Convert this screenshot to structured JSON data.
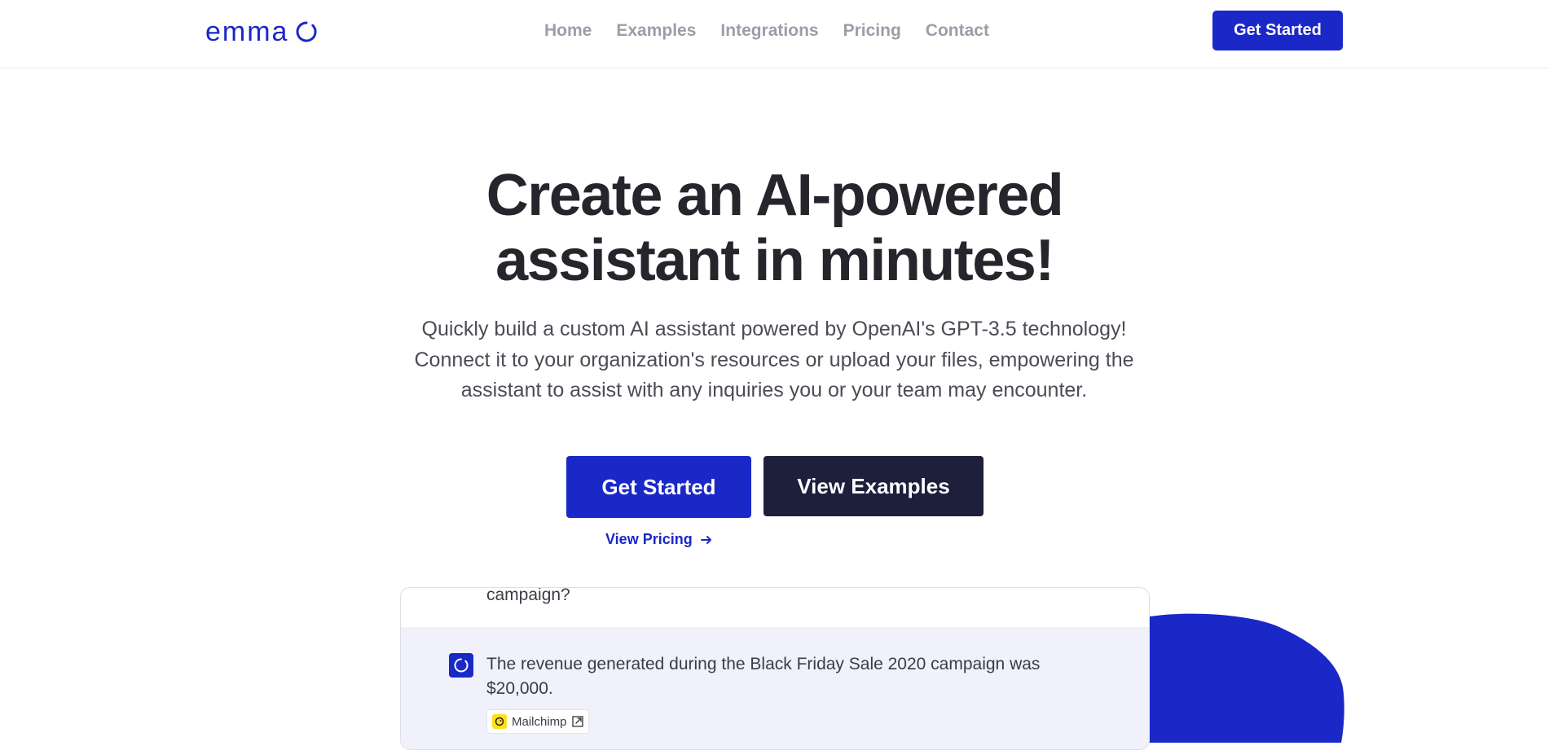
{
  "brand": {
    "name": "emma",
    "primary_color": "#1a28c8",
    "dark_color": "#1d1f3b"
  },
  "nav": {
    "items": [
      "Home",
      "Examples",
      "Integrations",
      "Pricing",
      "Contact"
    ]
  },
  "header": {
    "cta_label": "Get Started"
  },
  "hero": {
    "title_line1": "Create an AI-powered",
    "title_line2": "assistant in minutes!",
    "subtitle": "Quickly build a custom AI assistant powered by OpenAI's GPT-3.5 technology! Connect it to your organization's resources or upload your files, empowering the assistant to assist with any inquiries you or your team may encounter.",
    "primary_cta": "Get Started",
    "secondary_cta": "View Examples",
    "pricing_link": "View Pricing"
  },
  "chat_demo": {
    "previous_message_tail": "campaign?",
    "answer": "The revenue generated during the Black Friday Sale 2020 campaign was $20,000.",
    "source_label": "Mailchimp",
    "source_icon": "mailchimp-icon"
  }
}
